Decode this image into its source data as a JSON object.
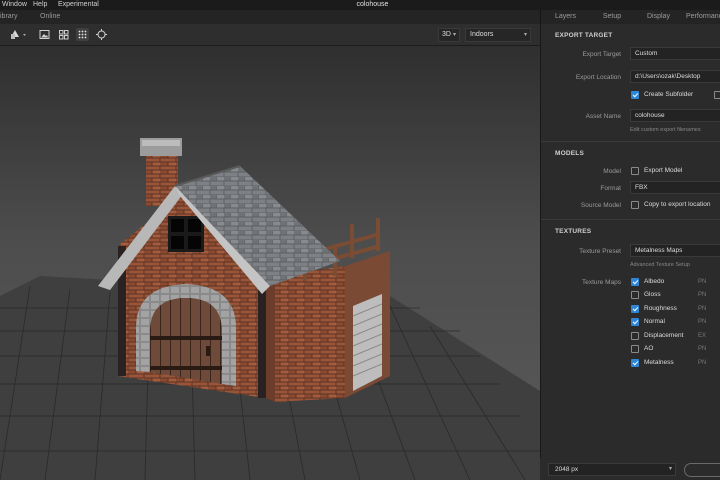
{
  "menubar": {
    "items": [
      "Window",
      "Help",
      "Experimental"
    ],
    "title": "colohouse"
  },
  "left_tabs": [
    "ibrary",
    "Online"
  ],
  "right_tabs": [
    "Layers",
    "Setup",
    "Display",
    "Performance"
  ],
  "toolbar": {
    "view_mode": "3D",
    "environment": "Indoors"
  },
  "export_target": {
    "heading": "EXPORT TARGET",
    "target_label": "Export Target",
    "target_value": "Custom",
    "location_label": "Export Location",
    "location_value": "d:\\Users\\ozak\\Desktop",
    "subfolder_label": "Create Subfolder",
    "subfolder_checked": true,
    "asset_label": "Asset Name",
    "asset_value": "colohouse",
    "asset_hint": "Edit custom export filenames"
  },
  "models": {
    "heading": "MODELS",
    "model_label": "Model",
    "export_model_label": "Export Model",
    "export_model_checked": false,
    "format_label": "Format",
    "format_value": "FBX",
    "source_label": "Source Model",
    "copy_label": "Copy to export location",
    "copy_checked": false
  },
  "textures": {
    "heading": "TEXTURES",
    "preset_label": "Texture Preset",
    "preset_value": "Metalness Maps",
    "preset_hint": "Advanced Texture Setup",
    "maps_label": "Texture Maps",
    "maps": [
      {
        "name": "Albedo",
        "checked": true,
        "format": "PN"
      },
      {
        "name": "Gloss",
        "checked": false,
        "format": "PN"
      },
      {
        "name": "Roughness",
        "checked": true,
        "format": "PN"
      },
      {
        "name": "Normal",
        "checked": true,
        "format": "PN"
      },
      {
        "name": "Displacement",
        "checked": false,
        "format": "EX"
      },
      {
        "name": "AO",
        "checked": false,
        "format": "PN"
      },
      {
        "name": "Metalness",
        "checked": true,
        "format": "PN"
      }
    ]
  },
  "bottom": {
    "resolution": "2048 px"
  },
  "colors": {
    "accent": "#2f86d6",
    "panel": "#2b2b2b",
    "brick": "#8a4b33"
  }
}
